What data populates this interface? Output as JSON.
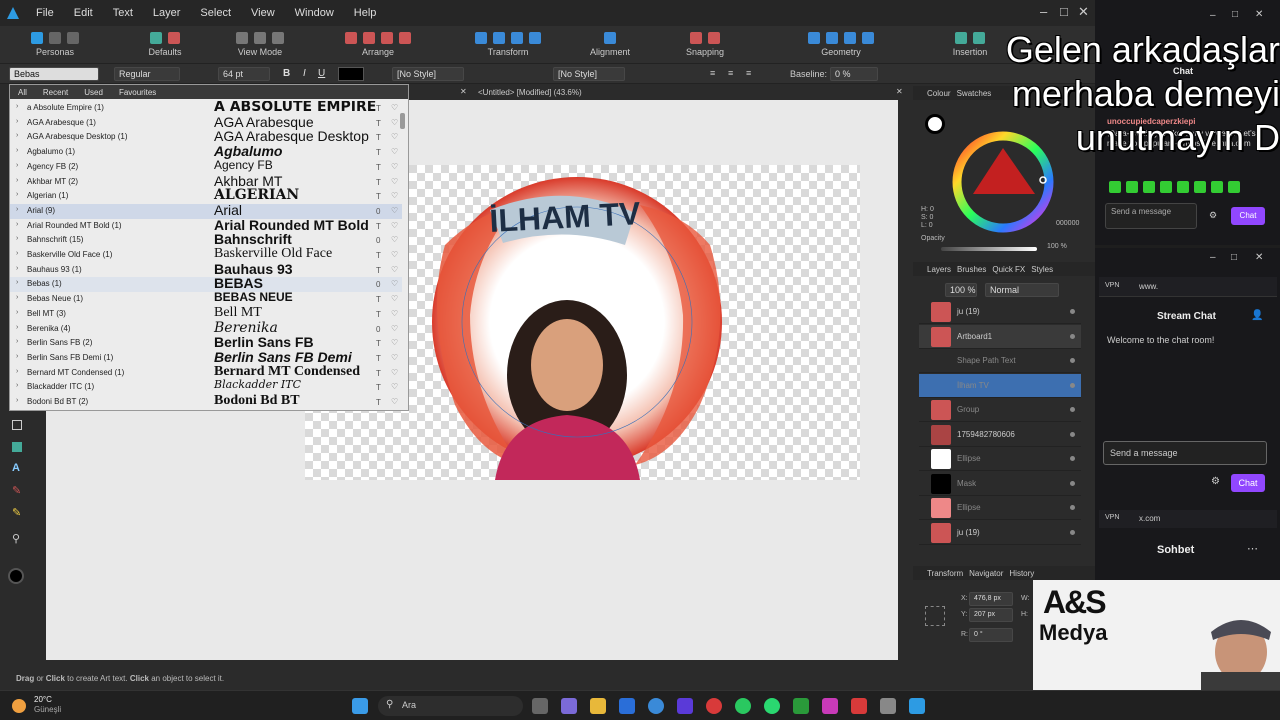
{
  "menubar": {
    "items": [
      "File",
      "Edit",
      "Text",
      "Layer",
      "Select",
      "View",
      "Window",
      "Help"
    ]
  },
  "toolbar": {
    "groups": [
      "Personas",
      "Defaults",
      "View Mode",
      "Arrange",
      "Transform",
      "Alignment",
      "Snapping",
      "Geometry",
      "Insertion"
    ]
  },
  "context": {
    "font_value": "Bebas",
    "style": "Regular",
    "size": "64 pt",
    "char_style": "[No Style]",
    "para_style": "[No Style]",
    "baseline_label": "Baseline:",
    "baseline_value": "0 %"
  },
  "font_panel": {
    "tabs": [
      "All",
      "Recent",
      "Used",
      "Favourites"
    ],
    "fonts": [
      {
        "name": "a Absolute Empire (1)",
        "preview": "A ABSOLUTE EMPIRE",
        "type": "T"
      },
      {
        "name": "AGA Arabesque (1)",
        "preview": "AGA Arabesque",
        "type": "T"
      },
      {
        "name": "AGA Arabesque Desktop (1)",
        "preview": "AGA Arabesque Desktop",
        "type": "T"
      },
      {
        "name": "Agbalumo (1)",
        "preview": "Agbalumo",
        "type": "T"
      },
      {
        "name": "Agency FB (2)",
        "preview": "Agency FB",
        "type": "T"
      },
      {
        "name": "Akhbar MT (2)",
        "preview": "Akhbar MT",
        "type": "T"
      },
      {
        "name": "Algerian (1)",
        "preview": "ALGERIAN",
        "type": "T"
      },
      {
        "name": "Arial (9)",
        "preview": "Arial",
        "type": "0"
      },
      {
        "name": "Arial Rounded MT Bold (1)",
        "preview": "Arial Rounded MT Bold",
        "type": "T"
      },
      {
        "name": "Bahnschrift (15)",
        "preview": "Bahnschrift",
        "type": "0"
      },
      {
        "name": "Baskerville Old Face (1)",
        "preview": "Baskerville Old Face",
        "type": "T"
      },
      {
        "name": "Bauhaus 93 (1)",
        "preview": "Bauhaus 93",
        "type": "T"
      },
      {
        "name": "Bebas (1)",
        "preview": "BEBAS",
        "type": "0"
      },
      {
        "name": "Bebas Neue (1)",
        "preview": "BEBAS NEUE",
        "type": "T"
      },
      {
        "name": "Bell MT (3)",
        "preview": "Bell MT",
        "type": "T"
      },
      {
        "name": "Berenika (4)",
        "preview": "Berenika",
        "type": "0"
      },
      {
        "name": "Berlin Sans FB (2)",
        "preview": "Berlin Sans FB",
        "type": "T"
      },
      {
        "name": "Berlin Sans FB Demi (1)",
        "preview": "Berlin Sans FB Demi",
        "type": "T"
      },
      {
        "name": "Bernard MT Condensed (1)",
        "preview": "Bernard MT Condensed",
        "type": "T"
      },
      {
        "name": "Blackadder ITC (1)",
        "preview": "Blackadder ITC",
        "type": "T"
      },
      {
        "name": "Bodoni Bd BT (2)",
        "preview": "Bodoni Bd BT",
        "type": "T"
      }
    ]
  },
  "document": {
    "tab": "<Untitled> [Modified] (43.6%)",
    "artboard_text": "İLHAM TV"
  },
  "right_panel": {
    "colour_tabs": [
      "Colour",
      "Swatches"
    ],
    "hex": "000000",
    "hsl_labels": [
      "H: 0",
      "S: 0",
      "L: 0"
    ],
    "opacity_label": "Opacity",
    "opacity": "100 %",
    "layer_tabs": [
      "Layers",
      "Brushes",
      "Quick FX",
      "Styles"
    ],
    "layer_opacity": "100 %",
    "blend": "Normal",
    "layers": [
      "ju (19)",
      "Artboard1",
      "Shape Path Text",
      "İlham TV",
      "Group",
      "1759482780606",
      "Ellipse",
      "Mask",
      "Ellipse",
      "ju (19)"
    ],
    "transform_tabs": [
      "Transform",
      "Navigator",
      "History"
    ],
    "x": "476,8 px",
    "y": "207 px",
    "r": "0 °",
    "w_label": "W:",
    "h_label": "H:"
  },
  "status": {
    "drag": "Drag",
    "or": " or ",
    "click": "Click",
    "rest": " to create Art text. ",
    "click2": "Click",
    "rest2": " an object to select it."
  },
  "overlay_text": "Gelen arkadaşlar merhaba demeyi unutmayın D",
  "chat1": {
    "title": "Chat",
    "user": "unoccupiedcaperzkiepi",
    "message": "@a-a-Would you like many viewers? Let's make you popular — https://nezhna.com",
    "send_placeholder": "Send a message",
    "button": "Chat"
  },
  "chat2": {
    "url": "www.",
    "title": "Stream Chat",
    "welcome": "Welcome to the chat room!",
    "send_placeholder": "Send a message",
    "button": "Chat"
  },
  "chat3": {
    "url": "x.com",
    "title": "Sohbet"
  },
  "webcam": {
    "brand": "A&S",
    "brand2": "Medya"
  },
  "taskbar": {
    "temp": "20°C",
    "weather": "Güneşli",
    "search": "Ara"
  }
}
